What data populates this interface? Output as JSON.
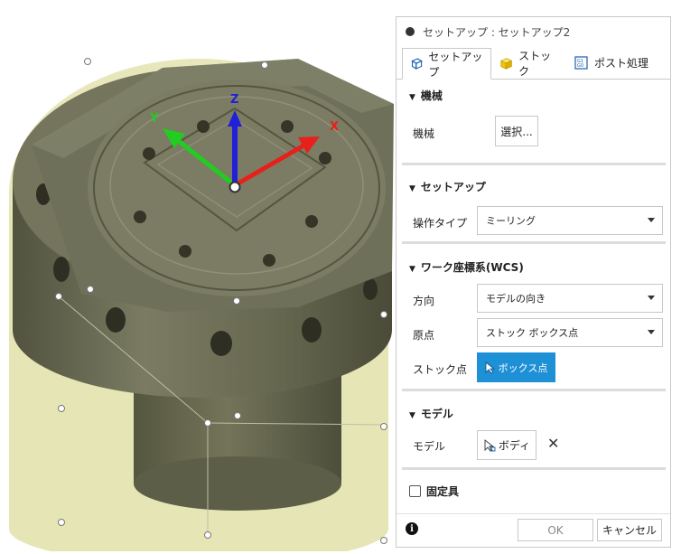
{
  "dialog": {
    "title": "セットアップ : セットアップ2",
    "tabs": [
      {
        "label": "セットアップ",
        "active": true
      },
      {
        "label": "ストック",
        "active": false
      },
      {
        "label": "ポスト処理",
        "active": false
      }
    ],
    "sections": {
      "machine": {
        "header": "機械",
        "field_label": "機械",
        "button_label": "選択..."
      },
      "setup": {
        "header": "セットアップ",
        "operation_type_label": "操作タイプ",
        "operation_type_value": "ミーリング"
      },
      "wcs": {
        "header": "ワーク座標系(WCS)",
        "orientation_label": "方向",
        "orientation_value": "モデルの向き",
        "origin_label": "原点",
        "origin_value": "ストック ボックス点",
        "stock_point_label": "ストック点",
        "stock_point_button": "ボックス点"
      },
      "model": {
        "header": "モデル",
        "field_label": "モデル",
        "selection_label": "ボディ"
      },
      "fixture": {
        "label": "固定具",
        "checked": false
      }
    },
    "footer": {
      "ok_label": "OK",
      "cancel_label": "キャンセル"
    }
  },
  "viewport": {
    "axes": {
      "x_label": "X",
      "y_label": "Y",
      "z_label": "Z"
    },
    "axis_colors": {
      "x": "#e8201c",
      "y": "#22cc22",
      "z": "#2020d8"
    }
  },
  "colors": {
    "accent": "#1e90d6",
    "panel_border": "#c9c9c9",
    "stock_fill": "#e7e6b8",
    "part_metal": "#6c6d58"
  }
}
